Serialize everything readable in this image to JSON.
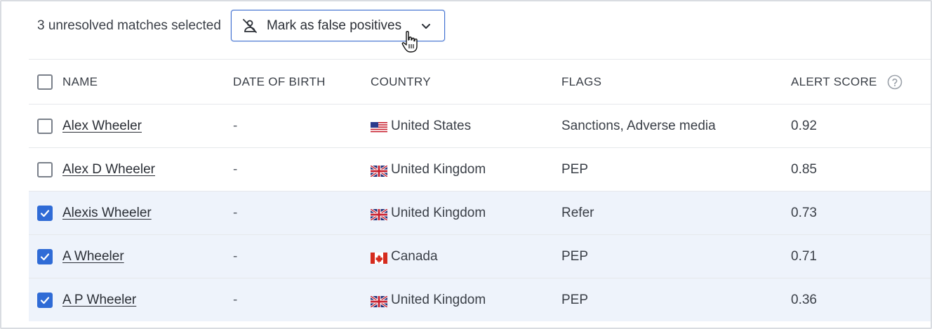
{
  "toolbar": {
    "selection_text": "3 unresolved matches selected",
    "action_label": "Mark as false positives"
  },
  "columns": {
    "name": "NAME",
    "dob": "DATE OF BIRTH",
    "country": "COUNTRY",
    "flags": "FLAGS",
    "score": "ALERT SCORE"
  },
  "rows": [
    {
      "name": "Alex Wheeler",
      "dob": "-",
      "country": "United States",
      "flag": "us-flag-icon",
      "flags": "Sanctions, Adverse media",
      "score": "0.92",
      "checked": false
    },
    {
      "name": "Alex D Wheeler",
      "dob": "-",
      "country": "United Kingdom",
      "flag": "uk-flag-icon",
      "flags": "PEP",
      "score": "0.85",
      "checked": false
    },
    {
      "name": "Alexis Wheeler",
      "dob": "-",
      "country": "United Kingdom",
      "flag": "uk-flag-icon",
      "flags": "Refer",
      "score": "0.73",
      "checked": true
    },
    {
      "name": "A Wheeler",
      "dob": "-",
      "country": "Canada",
      "flag": "canada-flag-icon",
      "flags": "PEP",
      "score": "0.71",
      "checked": true
    },
    {
      "name": "A P Wheeler",
      "dob": "-",
      "country": "United Kingdom",
      "flag": "uk-flag-icon",
      "flags": "PEP",
      "score": "0.36",
      "checked": true
    }
  ],
  "colors": {
    "accent": "#2f6bd6",
    "selected_row_bg": "#eef3fb",
    "border": "#e6e8eb"
  }
}
